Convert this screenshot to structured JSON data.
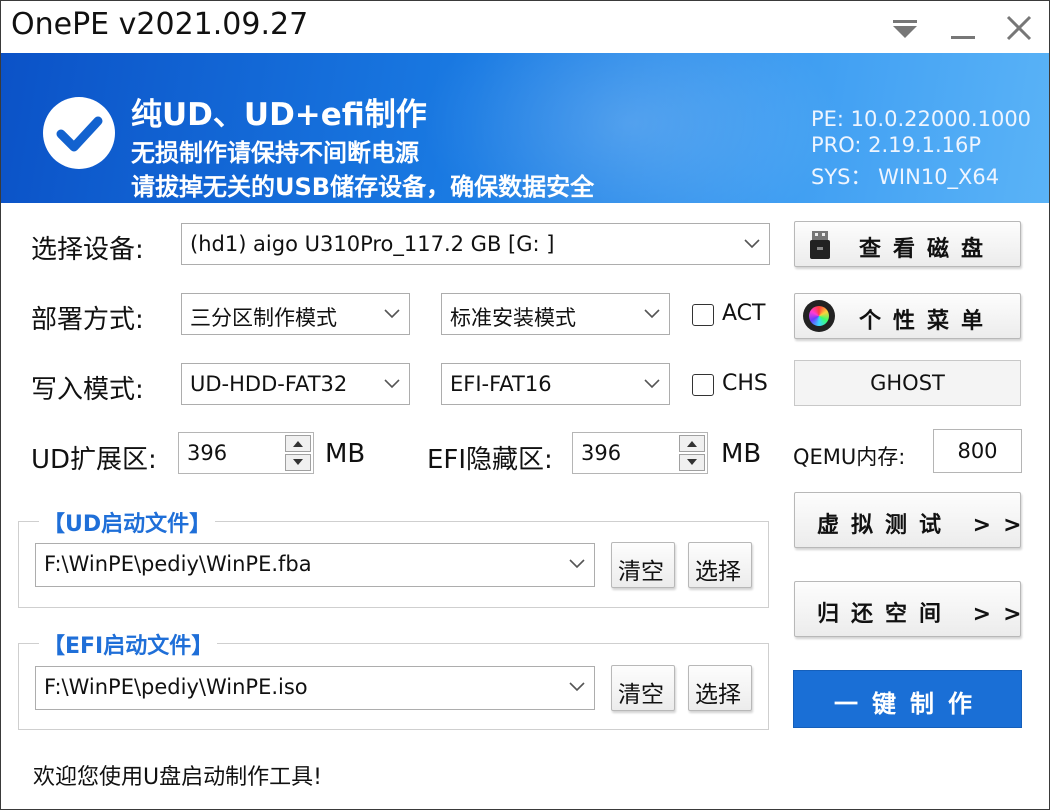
{
  "window": {
    "title": "OnePE v2021.09.27"
  },
  "banner": {
    "title": "纯UD、UD+efi制作",
    "line1": "无损制作请保持不间断电源",
    "line2": "请拔掉无关的USB储存设备，确保数据安全",
    "pe": "PE: 10.0.22000.1000",
    "pro": "PRO: 2.19.1.16P",
    "sys": "SYS：  WIN10_X64",
    "gradient_start": "#0b52c7",
    "gradient_end": "#5ab3f7"
  },
  "device": {
    "label": "选择设备:",
    "value": "(hd1) aigo U310Pro_117.2 GB [G: ]"
  },
  "deploy": {
    "label": "部署方式:",
    "mode": "三分区制作模式",
    "install": "标准安装模式",
    "act_label": "ACT",
    "act_checked": false
  },
  "write": {
    "label": "写入模式:",
    "ud_format": "UD-HDD-FAT32",
    "efi_format": "EFI-FAT16",
    "chs_label": "CHS",
    "chs_checked": false
  },
  "ud_ext": {
    "label": "UD扩展区:",
    "value": "396",
    "unit": "MB"
  },
  "efi_hidden": {
    "label": "EFI隐藏区:",
    "value": "396",
    "unit": "MB"
  },
  "qemu": {
    "label": "QEMU内存:",
    "value": "800"
  },
  "ud_boot": {
    "title": "【UD启动文件】",
    "path": "F:\\WinPE\\pediy\\WinPE.fba",
    "clear": "清空",
    "choose": "选择"
  },
  "efi_boot": {
    "title": "【EFI启动文件】",
    "path": "F:\\WinPE\\pediy\\WinPE.iso",
    "clear": "清空",
    "choose": "选择"
  },
  "side": {
    "view_disk": "查看磁盘",
    "menu": "个性菜单",
    "ghost": "GHOST",
    "vm_test": "虚拟测试 >>",
    "restore": "归还空间 >>",
    "make": "一键制作",
    "accent": "#1a6fd6"
  },
  "status": "欢迎您使用U盘启动制作工具!"
}
